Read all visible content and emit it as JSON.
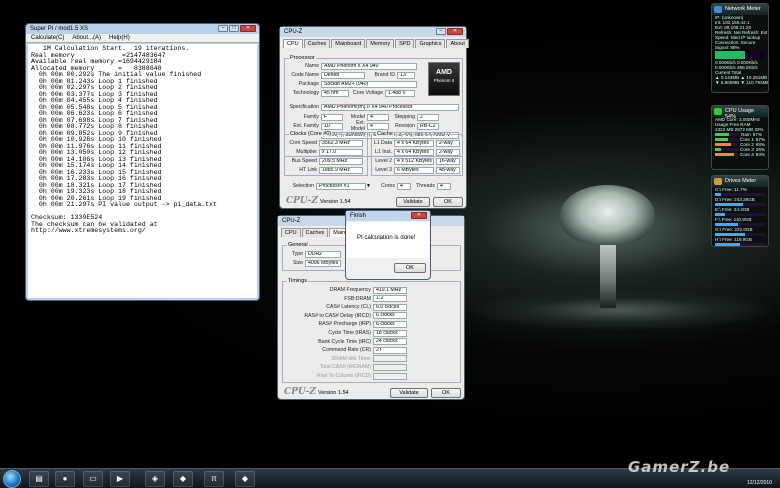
{
  "superpi": {
    "title": "Super PI / mod1.5 XS",
    "menu": [
      "Calculate(C)",
      "About...(A)",
      "Help(H)"
    ],
    "output": [
      "   1M Calculation Start.  19 iterations.",
      "Real memory            =2147483647",
      "Available real memory =1694429184",
      "Allocated memory      =   8388648",
      "  0h 00m 00.292s The initial value finished",
      "  0h 00m 01.243s Loop 1 finished",
      "  0h 00m 02.297s Loop 2 finished",
      "  0h 00m 03.377s Loop 3 finished",
      "  0h 00m 04.455s Loop 4 finished",
      "  0h 00m 05.548s Loop 5 finished",
      "  0h 00m 06.623s Loop 6 finished",
      "  0h 00m 07.698s Loop 7 finished",
      "  0h 00m 08.772s Loop 8 finished",
      "  0h 00m 09.852s Loop 9 finished",
      "  0h 00m 10.926s Loop 10 finished",
      "  0h 00m 11.976s Loop 11 finished",
      "  0h 00m 13.050s Loop 12 finished",
      "  0h 00m 14.106s Loop 13 finished",
      "  0h 00m 15.174s Loop 14 finished",
      "  0h 00m 16.233s Loop 15 finished",
      "  0h 00m 17.283s Loop 16 finished",
      "  0h 00m 18.321s Loop 17 finished",
      "  0h 00m 19.323s Loop 18 finished",
      "  0h 00m 20.261s Loop 19 finished",
      "  0h 00m 21.297s PI value output -> pi_data.txt",
      "",
      "Checksum: 1339E524",
      "The checksum can be validated at",
      "http://www.xtremesystems.org/"
    ]
  },
  "cpuz1": {
    "title": "CPU-Z",
    "tabs": [
      "CPU",
      "Caches",
      "Mainboard",
      "Memory",
      "SPD",
      "Graphics",
      "About"
    ],
    "processor_label": "Processor",
    "name_label": "Name",
    "name": "AMD Phenom II X4 940",
    "codename_label": "Code Name",
    "codename": "Deneb",
    "brandid_label": "Brand ID",
    "brandid": "13",
    "package_label": "Package",
    "package": "Socket AM2+ (940)",
    "technology_label": "Technology",
    "technology": "45 nm",
    "voltage_label": "Core Voltage",
    "voltage": "1.488 V",
    "spec_label": "Specification",
    "spec": "AMD Phenom(tm) II X4 940 Processor",
    "family_label": "Family",
    "family": "F",
    "model_label": "Model",
    "model": "4",
    "stepping_label": "Stepping",
    "stepping": "2",
    "extfamily_label": "Ext. Family",
    "extfamily": "10",
    "extmodel_label": "Ext. Model",
    "extmodel": "4",
    "revision_label": "Revision",
    "revision": "RB-C2",
    "instructions_label": "Instructions",
    "instructions": "MMX(+), 3DNow!(+), SSE (1, 2, 3, 4A), x86-64, AMD-V",
    "clocks_label": "Clocks (Core #0)",
    "corespeed_label": "Core Speed",
    "corespeed": "3562.3 MHz",
    "multiplier_label": "Multiplier",
    "multiplier": "x 17.0",
    "busspeed_label": "Bus Speed",
    "busspeed": "209.5 MHz",
    "htlink_label": "HT Link",
    "htlink": "1885.9 MHz",
    "cache_label": "Cache",
    "l1d_label": "L1 Data",
    "l1d": "4 x 64 KBytes",
    "l1d_way": "2-way",
    "l1i_label": "L1 Inst.",
    "l1i": "4 x 64 KBytes",
    "l1i_way": "2-way",
    "l2_label": "Level 2",
    "l2": "4 x 512 KBytes",
    "l2_way": "16-way",
    "l3_label": "Level 3",
    "l3": "6 MBytes",
    "l3_way": "48-way",
    "selection_label": "Selection",
    "selection": "Processor #1",
    "cores_label": "Cores",
    "cores": "4",
    "threads_label": "Threads",
    "threads": "4",
    "version": "Version 1.54",
    "validate": "Validate",
    "ok": "OK",
    "logo_top": "AMD",
    "logo_bottom": "Phenom II"
  },
  "cpuz2": {
    "title": "CPU-Z",
    "tabs": [
      "CPU",
      "Caches",
      "Mainboard"
    ],
    "general_label": "General",
    "type_label": "Type",
    "type": "DDR2",
    "size_label": "Size",
    "size": "4096 MBytes",
    "timings_label": "Timings",
    "timings": [
      {
        "label": "DRAM Frequency",
        "value": "419.1 MHz",
        "dim": false
      },
      {
        "label": "FSB:DRAM",
        "value": "1:2",
        "dim": false
      },
      {
        "label": "CAS# Latency (CL)",
        "value": "6.0 clocks",
        "dim": false
      },
      {
        "label": "RAS# to CAS# Delay (tRCD)",
        "value": "6 clocks",
        "dim": false
      },
      {
        "label": "RAS# Precharge (tRP)",
        "value": "6 clocks",
        "dim": false
      },
      {
        "label": "Cycle Time (tRAS)",
        "value": "18 clocks",
        "dim": false
      },
      {
        "label": "Bank Cycle Time (tRC)",
        "value": "24 clocks",
        "dim": false
      },
      {
        "label": "Command Rate (CR)",
        "value": "2T",
        "dim": false
      },
      {
        "label": "DRAM Idle Timer",
        "value": "",
        "dim": true
      },
      {
        "label": "Total CAS# (tRDRAM)",
        "value": "",
        "dim": true
      },
      {
        "label": "Row To Column (tRCD)",
        "value": "",
        "dim": true
      }
    ],
    "version": "Version 1.54",
    "validate": "Validate",
    "ok": "OK"
  },
  "finish": {
    "title": "Finish",
    "message": "PI calculation is done!",
    "ok": "OK"
  },
  "network": {
    "title": "Network Meter",
    "lines": [
      "IP: (unknown)",
      "Int: 192.168.42.1",
      "Ext: 89.108.21.20",
      "Refresh: Net  Refresh: Ext IP",
      "Speed: Med   IP lookup",
      "Connection: Secure",
      "Signal: 88%"
    ],
    "stats": [
      "0.000Kb/s  0.000Kb/s",
      "0.000Kb/s  498.0Kb/s"
    ],
    "current": "Current     Total",
    "totals": [
      "▲ 0.144MB  ▲ 10.261MB",
      "▼ 5.900MB  ▼ 110.793MB"
    ]
  },
  "cpu_usage": {
    "title": "CPU Usage 54%",
    "lines": [
      "AMD      Core: 3.000MHz",
      "Usage    Free    RAM",
      "1322 MB  2872 MB  32%"
    ],
    "cores": [
      {
        "name": "Ram",
        "value": "57%",
        "level": 0.57
      },
      {
        "name": "Core 1",
        "value": "57%",
        "level": 0.57
      },
      {
        "name": "Core 2",
        "value": "68%",
        "level": 0.68
      },
      {
        "name": "Core 3",
        "value": "26%",
        "level": 0.26
      },
      {
        "name": "Core 4",
        "value": "83%",
        "level": 0.83
      }
    ]
  },
  "drives": {
    "title": "Drives Meter",
    "lines": [
      "C:\\  Free: 11.7%",
      "D:\\  Free: 243.28GB",
      "E:\\  Free: 24.3GB",
      "F:\\  Free: 110.9GB",
      "G:\\  Free: 222.0GB",
      "H:\\  Free: 119.9GB"
    ],
    "levels": [
      0.12,
      0.55,
      0.2,
      0.45,
      0.6,
      0.5
    ]
  },
  "taskbar": {
    "clock": "12/12/2010"
  },
  "watermark": "GamerZ.be"
}
